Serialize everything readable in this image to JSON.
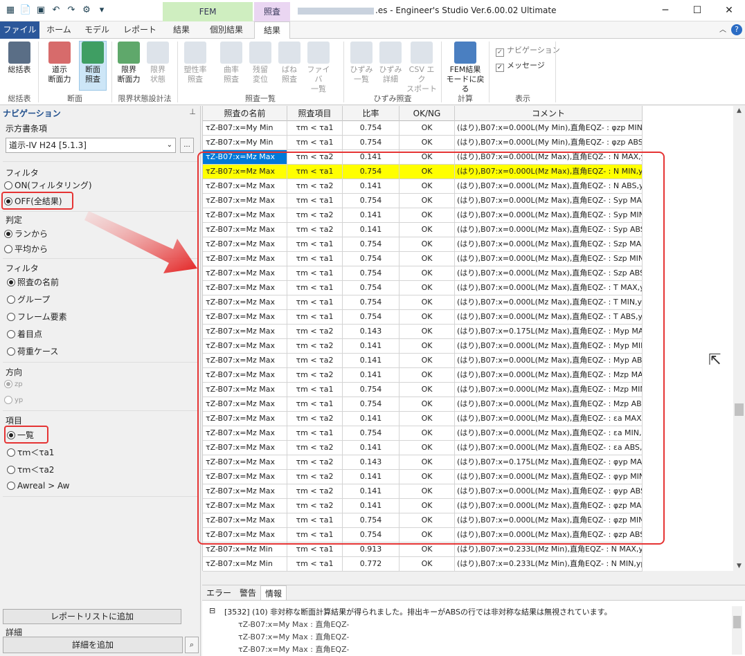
{
  "window": {
    "title": ".es - Engineer's Studio Ver.6.00.02 Ultimate",
    "context_fem": "FEM",
    "context_check": "照査",
    "minimize": "─",
    "maximize": "☐",
    "close": "✕"
  },
  "tabs": [
    "ファイル",
    "ホーム",
    "モデル",
    "レポート",
    "結果",
    "個別結果",
    "結果"
  ],
  "ribbon": {
    "summary": {
      "label": "総括表",
      "group": "総括表"
    },
    "section": {
      "items": [
        "道示\n断面力",
        "断面\n照査"
      ],
      "group": "断面"
    },
    "limit": {
      "items": [
        "限界\n断面力",
        "限界\n状態"
      ],
      "group": "限界状態設計法"
    },
    "check_list": {
      "items": [
        "塑性率\n照査",
        "曲率\n照査",
        "残留\n変位",
        "ばね\n照査",
        "ファイバ\n一覧"
      ],
      "group": "照査一覧"
    },
    "strain": {
      "items": [
        "ひずみ\n一覧",
        "ひずみ\n詳細",
        "CSV エク\nスポート"
      ],
      "group": "ひずみ照査"
    },
    "calc": {
      "label": "FEM結果\nモードに戻る",
      "group": "計算"
    },
    "display": {
      "navigation": "ナビゲーション",
      "message": "メッセージ",
      "group": "表示"
    }
  },
  "nav": {
    "title": "ナビゲーション",
    "pin": "ᵖ",
    "spec_label": "示方書条項",
    "spec_value": "道示-IV H24 [5.1.3]",
    "spec_btn": "...",
    "filter_label": "フィルタ",
    "filter_on": "ON(フィルタリング)",
    "filter_off": "OFF(全結果)",
    "judge_label": "判定",
    "judge_ran": "ランから",
    "judge_avg": "平均から",
    "filter2_label": "フィルタ",
    "filter2_items": [
      "照査の名前",
      "グループ",
      "フレーム要素",
      "着目点",
      "荷重ケース"
    ],
    "direction_label": "方向",
    "direction_items": [
      "zp",
      "yp"
    ],
    "item_label": "項目",
    "item_items": [
      "一覧",
      "τｍ＜τa1",
      "τｍ＜τa2",
      "Awreal > Aw"
    ],
    "report_btn": "レポートリストに追加",
    "detail_label": "詳細",
    "detail_btn": "詳細を追加"
  },
  "grid": {
    "columns": [
      "照査の名前",
      "照査項目",
      "比率",
      "OK/NG",
      "コメント"
    ],
    "rows": [
      [
        "τZ-B07:x=My Min",
        "τm < τa1",
        "0.754",
        "OK",
        "(はり),B07:x=0.000L(My Min),直角EQZ- : φzp MIN,yp"
      ],
      [
        "τZ-B07:x=My Min",
        "τm < τa1",
        "0.754",
        "OK",
        "(はり),B07:x=0.000L(My Min),直角EQZ- : φzp ABS,yp"
      ],
      [
        "τZ-B07:x=Mz Max",
        "τm < τa2",
        "0.141",
        "OK",
        "(はり),B07:x=0.000L(Mz Max),直角EQZ- : N MAX,yp"
      ],
      [
        "τZ-B07:x=Mz Max",
        "τm < τa1",
        "0.754",
        "OK",
        "(はり),B07:x=0.000L(Mz Max),直角EQZ- : N MIN,yp"
      ],
      [
        "τZ-B07:x=Mz Max",
        "τm < τa2",
        "0.141",
        "OK",
        "(はり),B07:x=0.000L(Mz Max),直角EQZ- : N ABS,yp"
      ],
      [
        "τZ-B07:x=Mz Max",
        "τm < τa1",
        "0.754",
        "OK",
        "(はり),B07:x=0.000L(Mz Max),直角EQZ- : Syp MAX,yp"
      ],
      [
        "τZ-B07:x=Mz Max",
        "τm < τa2",
        "0.141",
        "OK",
        "(はり),B07:x=0.000L(Mz Max),直角EQZ- : Syp MIN,yp"
      ],
      [
        "τZ-B07:x=Mz Max",
        "τm < τa2",
        "0.141",
        "OK",
        "(はり),B07:x=0.000L(Mz Max),直角EQZ- : Syp ABS,yp"
      ],
      [
        "τZ-B07:x=Mz Max",
        "τm < τa1",
        "0.754",
        "OK",
        "(はり),B07:x=0.000L(Mz Max),直角EQZ- : Szp MAX,yp"
      ],
      [
        "τZ-B07:x=Mz Max",
        "τm < τa1",
        "0.754",
        "OK",
        "(はり),B07:x=0.000L(Mz Max),直角EQZ- : Szp MIN,yp"
      ],
      [
        "τZ-B07:x=Mz Max",
        "τm < τa1",
        "0.754",
        "OK",
        "(はり),B07:x=0.000L(Mz Max),直角EQZ- : Szp ABS,yp"
      ],
      [
        "τZ-B07:x=Mz Max",
        "τm < τa1",
        "0.754",
        "OK",
        "(はり),B07:x=0.000L(Mz Max),直角EQZ- : T MAX,yp"
      ],
      [
        "τZ-B07:x=Mz Max",
        "τm < τa1",
        "0.754",
        "OK",
        "(はり),B07:x=0.000L(Mz Max),直角EQZ- : T MIN,yp"
      ],
      [
        "τZ-B07:x=Mz Max",
        "τm < τa1",
        "0.754",
        "OK",
        "(はり),B07:x=0.000L(Mz Max),直角EQZ- : T ABS,yp"
      ],
      [
        "τZ-B07:x=Mz Max",
        "τm < τa2",
        "0.143",
        "OK",
        "(はり),B07:x=0.175L(Mz Max),直角EQZ- : Myp MAX,yp"
      ],
      [
        "τZ-B07:x=Mz Max",
        "τm < τa2",
        "0.141",
        "OK",
        "(はり),B07:x=0.000L(Mz Max),直角EQZ- : Myp MIN,yp"
      ],
      [
        "τZ-B07:x=Mz Max",
        "τm < τa2",
        "0.141",
        "OK",
        "(はり),B07:x=0.000L(Mz Max),直角EQZ- : Myp ABS,yp"
      ],
      [
        "τZ-B07:x=Mz Max",
        "τm < τa2",
        "0.141",
        "OK",
        "(はり),B07:x=0.000L(Mz Max),直角EQZ- : Mzp MAX,yp"
      ],
      [
        "τZ-B07:x=Mz Max",
        "τm < τa1",
        "0.754",
        "OK",
        "(はり),B07:x=0.000L(Mz Max),直角EQZ- : Mzp MIN,yp"
      ],
      [
        "τZ-B07:x=Mz Max",
        "τm < τa1",
        "0.754",
        "OK",
        "(はり),B07:x=0.000L(Mz Max),直角EQZ- : Mzp ABS,yp"
      ],
      [
        "τZ-B07:x=Mz Max",
        "τm < τa2",
        "0.141",
        "OK",
        "(はり),B07:x=0.000L(Mz Max),直角EQZ- : εa MAX,yp"
      ],
      [
        "τZ-B07:x=Mz Max",
        "τm < τa1",
        "0.754",
        "OK",
        "(はり),B07:x=0.000L(Mz Max),直角EQZ- : εa MIN,yp"
      ],
      [
        "τZ-B07:x=Mz Max",
        "τm < τa2",
        "0.141",
        "OK",
        "(はり),B07:x=0.000L(Mz Max),直角EQZ- : εa ABS,yp"
      ],
      [
        "τZ-B07:x=Mz Max",
        "τm < τa2",
        "0.143",
        "OK",
        "(はり),B07:x=0.175L(Mz Max),直角EQZ- : φyp MAX,yp"
      ],
      [
        "τZ-B07:x=Mz Max",
        "τm < τa2",
        "0.141",
        "OK",
        "(はり),B07:x=0.000L(Mz Max),直角EQZ- : φyp MIN,yp"
      ],
      [
        "τZ-B07:x=Mz Max",
        "τm < τa2",
        "0.141",
        "OK",
        "(はり),B07:x=0.000L(Mz Max),直角EQZ- : φyp ABS,yp"
      ],
      [
        "τZ-B07:x=Mz Max",
        "τm < τa2",
        "0.141",
        "OK",
        "(はり),B07:x=0.000L(Mz Max),直角EQZ- : φzp MAX,yp"
      ],
      [
        "τZ-B07:x=Mz Max",
        "τm < τa1",
        "0.754",
        "OK",
        "(はり),B07:x=0.000L(Mz Max),直角EQZ- : φzp MIN,yp"
      ],
      [
        "τZ-B07:x=Mz Max",
        "τm < τa1",
        "0.754",
        "OK",
        "(はり),B07:x=0.000L(Mz Max),直角EQZ- : φzp ABS,yp"
      ],
      [
        "τZ-B07:x=Mz Min",
        "τm < τa1",
        "0.913",
        "OK",
        "(はり),B07:x=0.233L(Mz Min),直角EQZ- : N MAX,yp"
      ],
      [
        "τZ-B07:x=Mz Min",
        "τm < τa1",
        "0.772",
        "OK",
        "(はり),B07:x=0.233L(Mz Min),直角EQZ- : N MIN,yp"
      ]
    ],
    "selected_row": 2,
    "highlight_row": 3,
    "highlight_color": "#ffff00",
    "selection_color": "#0078d7"
  },
  "messages": {
    "tabs": [
      "エラー",
      "警告",
      "情報"
    ],
    "active_tab": "情報",
    "lines": [
      "[3532] (10) 非対称な断面計算結果が得られました。排出キーがABSの行では非対称な結果は無視されています。",
      "τZ-B07:x=My Max : 直角EQZ-",
      "τZ-B07:x=My Max : 直角EQZ-",
      "τZ-B07:x=My Max : 直角EQZ-"
    ],
    "expander": "⊟"
  },
  "colors": {
    "annotation_red": "#e53333",
    "file_tab": "#2b579a"
  }
}
